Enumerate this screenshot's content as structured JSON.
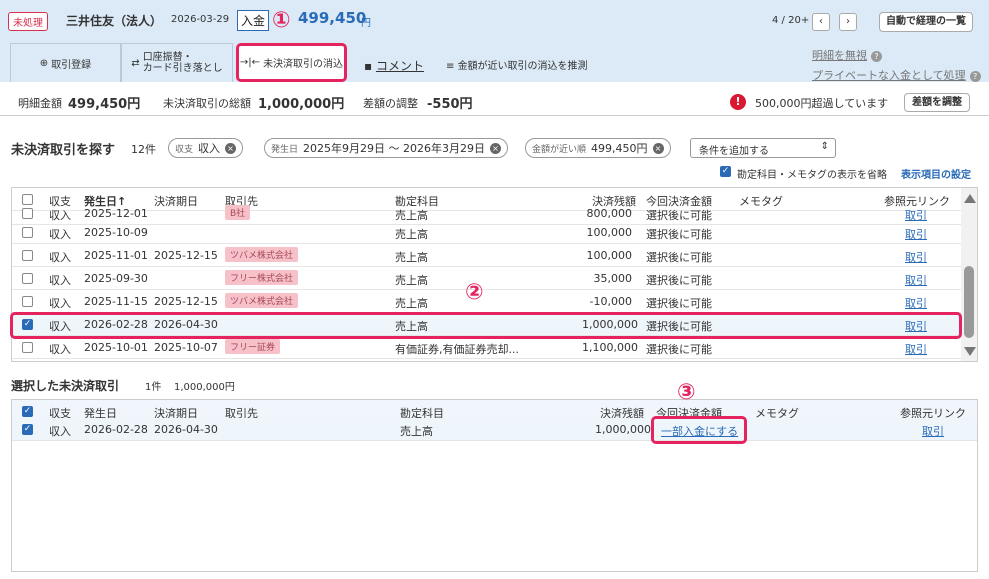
{
  "header": {
    "status": "未処理",
    "bank": "三井住友（法人）",
    "date": "2026-03-29",
    "type": "入金",
    "amount": "499,450",
    "yen": "円",
    "counter": "4 / 20+",
    "prev": "‹",
    "next": "›",
    "auto_button": "自動で経理の一覧"
  },
  "tabs": [
    {
      "label": "取引登録",
      "icon": "plus-circle-icon"
    },
    {
      "label": "口座振替・\nカード引き落とし",
      "icon": "transfer-icon"
    },
    {
      "label": "未決済取引の消込",
      "icon": "reconcile-icon"
    },
    {
      "label": "コメント",
      "icon": "comment-icon"
    },
    {
      "label": "金額が近い取引の消込を推測",
      "icon": "list-icon"
    }
  ],
  "side_links": {
    "ignore": "明細を無視",
    "private": "プライベートな入金として処理"
  },
  "summary": {
    "detail_label": "明細金額",
    "detail_value": "499,450円",
    "total_label": "未決済取引の総額",
    "total_value": "1,000,000円",
    "adjust_label": "差額の調整",
    "adjust_value": "-550円",
    "warning": "500,000円超過しています",
    "adjust_button": "差額を調整"
  },
  "search": {
    "title": "未決済取引を探す",
    "count": "12件",
    "chips": [
      {
        "key": "収支",
        "value": "収入"
      },
      {
        "key": "発生日",
        "value": "2025年9月29日 〜 2026年3月29日"
      },
      {
        "key": "金額が近い順",
        "value": "499,450円"
      }
    ],
    "add_condition": "条件を追加する",
    "omit_label": "勘定科目・メモタグの表示を省略",
    "settings": "表示項目の設定"
  },
  "columns": [
    "収支",
    "発生日↑",
    "決済期日",
    "取引先",
    "勘定科目",
    "決済残額",
    "今回決済金額",
    "メモタグ",
    "参照元リンク"
  ],
  "rows": [
    {
      "kind": "収入",
      "date": "2025-12-01",
      "due": "",
      "partner": "B社",
      "account": "売上高",
      "remain": "800,000",
      "pay": "選択後に可能",
      "link": "取引",
      "checked": false
    },
    {
      "kind": "収入",
      "date": "2025-10-09",
      "due": "",
      "partner": "",
      "account": "売上高",
      "remain": "100,000",
      "pay": "選択後に可能",
      "link": "取引",
      "checked": false
    },
    {
      "kind": "収入",
      "date": "2025-11-01",
      "due": "2025-12-15",
      "partner": "ツバメ株式会社",
      "account": "売上高",
      "remain": "100,000",
      "pay": "選択後に可能",
      "link": "取引",
      "checked": false
    },
    {
      "kind": "収入",
      "date": "2025-09-30",
      "due": "",
      "partner": "フリー株式会社",
      "account": "売上高",
      "remain": "35,000",
      "pay": "選択後に可能",
      "link": "取引",
      "checked": false
    },
    {
      "kind": "収入",
      "date": "2025-11-15",
      "due": "2025-12-15",
      "partner": "ツバメ株式会社",
      "account": "売上高",
      "remain": "-10,000",
      "pay": "選択後に可能",
      "link": "取引",
      "checked": false
    },
    {
      "kind": "収入",
      "date": "2026-02-28",
      "due": "2026-04-30",
      "partner": "",
      "account": "売上高",
      "remain": "1,000,000",
      "pay": "選択後に可能",
      "link": "取引",
      "checked": true
    },
    {
      "kind": "収入",
      "date": "2025-10-01",
      "due": "2025-10-07",
      "partner": "フリー証券",
      "account": "有価証券,有価証券売却...",
      "remain": "1,100,000",
      "pay": "選択後に可能",
      "link": "取引",
      "checked": false
    }
  ],
  "selected": {
    "title": "選択した未決済取引",
    "count": "1件",
    "total": "1,000,000円",
    "columns": [
      "収支",
      "発生日",
      "決済期日",
      "取引先",
      "勘定科目",
      "決済残額",
      "今回決済金額",
      "メモタグ",
      "参照元リンク"
    ],
    "row": {
      "kind": "収入",
      "date": "2026-02-28",
      "due": "2026-04-30",
      "partner": "",
      "account": "売上高",
      "remain": "1,000,000",
      "pay": "一部入金にする",
      "link": "取引"
    }
  },
  "markers": [
    "①",
    "②",
    "③"
  ]
}
